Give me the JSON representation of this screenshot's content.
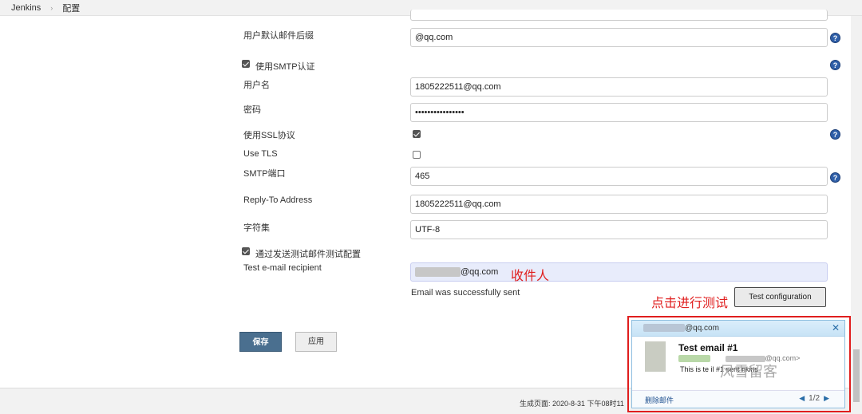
{
  "breadcrumb": {
    "root": "Jenkins",
    "page": "配置"
  },
  "form": {
    "suffix_label": "用户默认邮件后缀",
    "suffix_value": "@qq.com",
    "smtp_auth_label": "使用SMTP认证",
    "username_label": "用户名",
    "username_value": "1805222511@qq.com",
    "password_label": "密码",
    "password_value": "••••••••••••••••",
    "ssl_label": "使用SSL协议",
    "tls_label": "Use TLS",
    "port_label": "SMTP端口",
    "port_value": "465",
    "reply_label": "Reply-To Address",
    "reply_value": "1805222511@qq.com",
    "charset_label": "字符集",
    "charset_value": "UTF-8",
    "test_checkbox_label": "通过发送测试邮件测试配置",
    "recipient_label": "Test e-mail recipient",
    "recipient_value": "@qq.com",
    "success_message": "Email was successfully sent",
    "test_button": "Test configuration"
  },
  "annotations": {
    "recipient_note": "收件人",
    "test_note": "点击进行测试"
  },
  "buttons": {
    "save": "保存",
    "apply": "应用"
  },
  "footer": {
    "generated": "生成页面: 2020-8-31 下午08时11"
  },
  "popup": {
    "from": "@qq.com",
    "subject": "Test email #1",
    "addr": "@qq.com>",
    "body": "This is te    il #1 sent    nkins",
    "watermark": "风雪留客",
    "delete": "删除邮件",
    "pager": "1/2"
  },
  "colors": {
    "accent": "#4a6f8f",
    "help": "#2f5fa8",
    "annotation": "#e02020",
    "highlight_field": "#e8ecfb"
  }
}
